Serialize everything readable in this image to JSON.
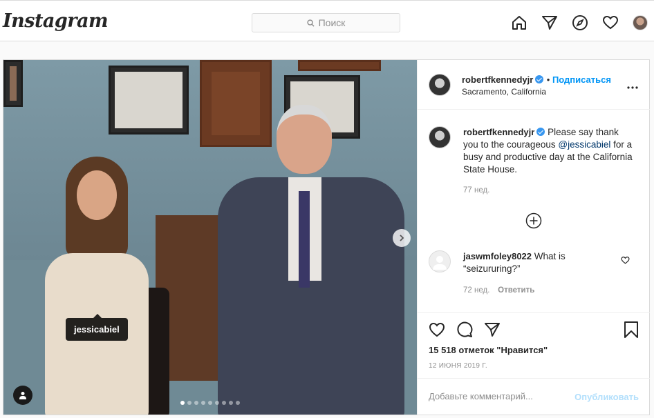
{
  "header": {
    "logo": "Instagram",
    "search_placeholder": "Поиск"
  },
  "post": {
    "author": "robertfkennedyjr",
    "verified": true,
    "follow_label": "Подписаться",
    "location": "Sacramento, California",
    "photo_tag": "jessicabiel",
    "carousel": {
      "total": 9,
      "current": 1
    },
    "caption": {
      "username": "robertfkennedyjr",
      "text_before": "Please say thank you to the courageous ",
      "mention": "@jessicabiel",
      "text_after": " for a busy and productive day at the California State House.",
      "time": "77 нед."
    },
    "comment": {
      "username": "jaswmfoley8022",
      "text": "What is “seizururing?”",
      "time": "72 нед.",
      "reply_label": "Ответить"
    },
    "likes": "15 518 отметок \"Нравится\"",
    "date": "12 ИЮНЯ 2019 Г.",
    "add_comment_placeholder": "Добавьте комментарий...",
    "publish_label": "Опубликовать"
  },
  "colors": {
    "accent": "#0095f6",
    "publish_disabled": "#b2dffc",
    "verified": "#3897f0"
  }
}
